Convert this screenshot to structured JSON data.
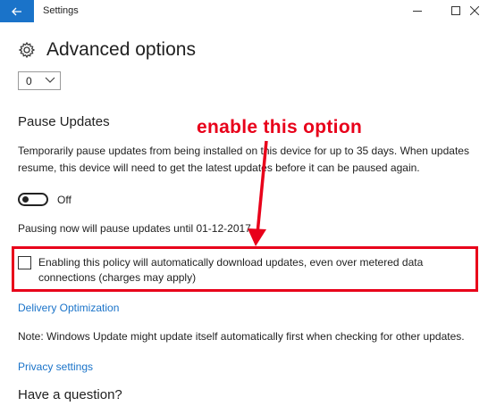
{
  "window": {
    "title": "Settings",
    "controls": [
      "minimize",
      "maximize",
      "close"
    ]
  },
  "header": {
    "icon": "gear-icon",
    "title": "Advanced options"
  },
  "dropdown": {
    "value": "0"
  },
  "pause_updates": {
    "title": "Pause Updates",
    "description": "Temporarily pause updates from being installed on this device for up to 35 days. When updates resume, this device will need to get the latest updates before it can be paused again.",
    "toggle_state": "Off",
    "pause_note": "Pausing now will pause updates until 01-12-2017"
  },
  "metered_option": {
    "checked": false,
    "label": "Enabling this policy will automatically download updates, even over metered data connections (charges may apply)"
  },
  "links": {
    "delivery": "Delivery Optimization",
    "privacy": "Privacy settings"
  },
  "note": "Note: Windows Update might update itself automatically first when checking for other updates.",
  "question": "Have a question?",
  "annotation": {
    "text": "enable this option",
    "color": "#e8001a"
  },
  "colors": {
    "accent": "#1a73c9",
    "highlight": "#e8001a"
  }
}
